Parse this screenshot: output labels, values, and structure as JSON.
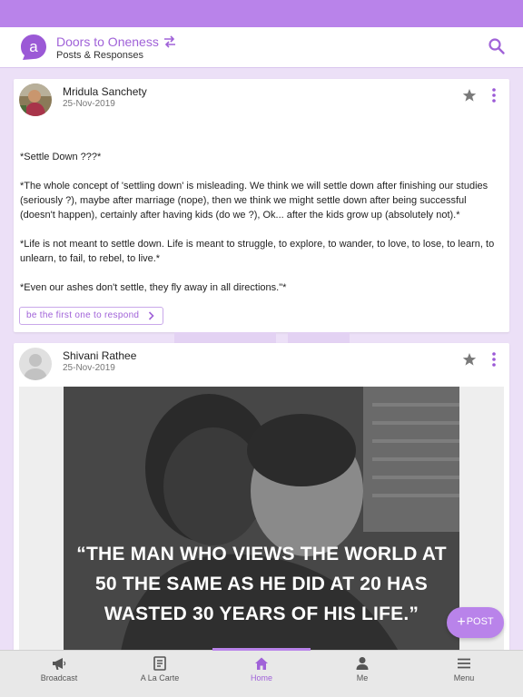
{
  "header": {
    "title": "Doors to Oneness",
    "subtitle": "Posts & Responses"
  },
  "posts": [
    {
      "author": "Mridula Sanchety",
      "date": "25-Nov-2019",
      "paragraphs": [
        "*Settle Down ???*",
        "*The whole concept of 'settling down' is misleading. We think we will settle down after finishing our studies (seriously ?), maybe after marriage (nope), then we think we might settle down after being successful (doesn't happen), certainly after having kids (do we ?), Ok... after the kids grow up (absolutely not).*",
        "*Life is not meant to settle down. Life is meant to struggle, to explore, to wander, to love, to lose, to learn, to unlearn, to fail, to rebel, to live.*",
        "*Even our ashes don't settle, they fly away in all directions.\"*"
      ],
      "respond_label": "be the first one to respond"
    },
    {
      "author": "Shivani Rathee",
      "date": "25-Nov-2019",
      "image_quote": "“THE MAN WHO VIEWS THE WORLD AT 50 THE SAME AS HE DID AT 20 HAS WASTED 30 YEARS OF HIS LIFE.”"
    }
  ],
  "fab": {
    "label": "POST"
  },
  "tabs": [
    {
      "label": "Broadcast",
      "icon": "megaphone-icon"
    },
    {
      "label": "A La Carte",
      "icon": "book-icon"
    },
    {
      "label": "Home",
      "icon": "home-icon",
      "active": true
    },
    {
      "label": "Me",
      "icon": "person-icon"
    },
    {
      "label": "Menu",
      "icon": "hamburger-icon"
    }
  ],
  "colors": {
    "accent": "#b983ea",
    "accent_text": "#a062d8",
    "feed_background": "#ece0f7"
  }
}
